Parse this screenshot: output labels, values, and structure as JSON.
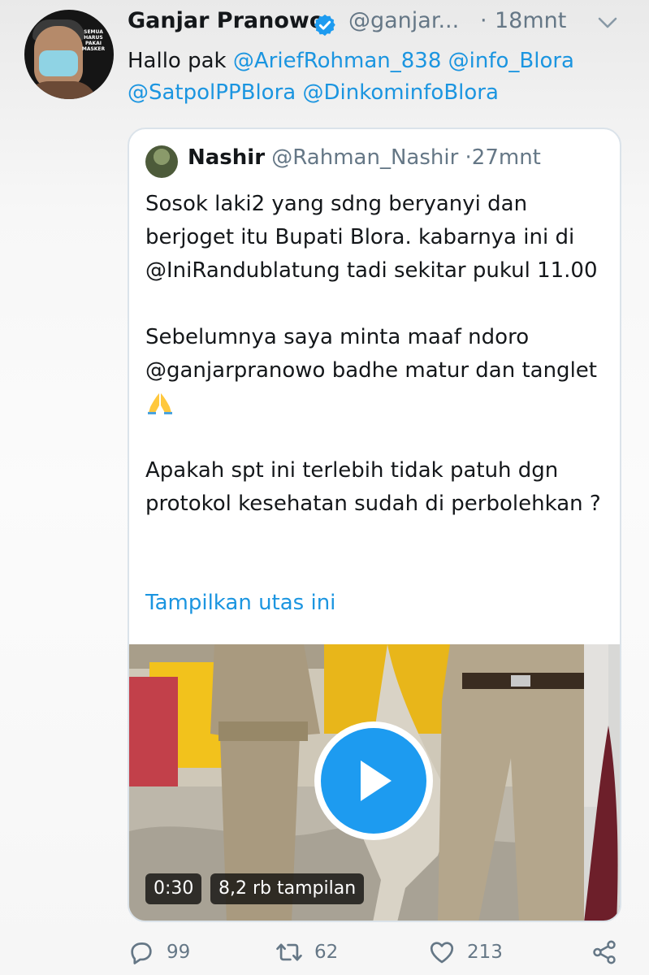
{
  "tweet": {
    "author_name": "Ganjar Pranowo",
    "author_handle": "@ganjar...",
    "separator": "·",
    "time": "18mnt",
    "avatar_sign": "SEMUA HARUS PAKAI MASKER",
    "text_prefix": "Hallo pak ",
    "mentions": [
      "@AriefRohman_838",
      "@info_Blora",
      "@SatpolPPBlora",
      "@DinkominfoBlora"
    ]
  },
  "quote": {
    "author_name": "Nashir",
    "author_handle": "@Rahman_Nashir",
    "separator": "·",
    "time": "27mnt",
    "para1": "Sosok laki2 yang sdng beryanyi dan berjoget itu Bupati Blora. kabarnya ini di @IniRandublatung tadi sekitar pukul 11.00",
    "para2_prefix": "Sebelumnya saya minta maaf ndoro @ganjarpranowo badhe matur dan tanglet",
    "para3": "Apakah spt ini terlebih tidak patuh dgn protokol kesehatan sudah di perbolehkan ?",
    "show_thread": "Tampilkan utas ini",
    "video": {
      "duration": "0:30",
      "views": "8,2 rb tampilan"
    }
  },
  "actions": {
    "reply_count": "99",
    "retweet_count": "62",
    "like_count": "213"
  },
  "colors": {
    "accent": "#1b95e0",
    "secondary_text": "#657786",
    "primary_text": "#14171a"
  },
  "icons": [
    "verified-badge-icon",
    "chevron-down-icon",
    "play-icon",
    "reply-icon",
    "retweet-icon",
    "like-icon",
    "share-icon",
    "folded-hands-emoji"
  ]
}
